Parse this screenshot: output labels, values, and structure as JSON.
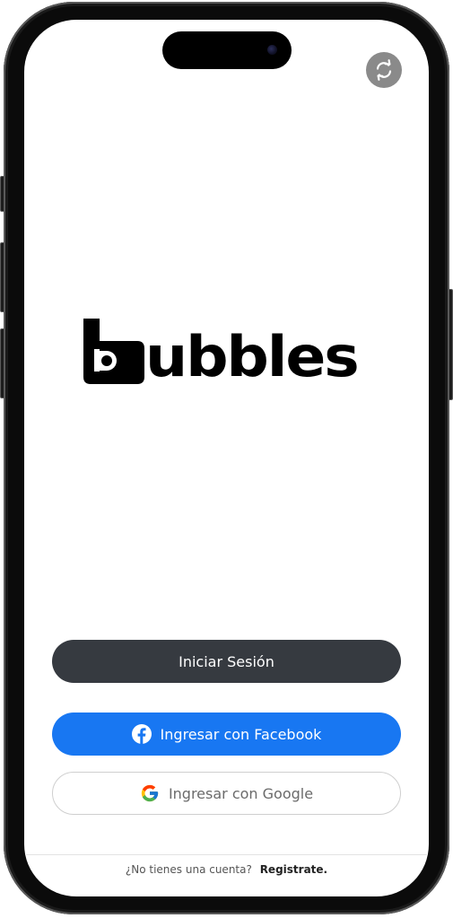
{
  "app": {
    "brand_name": "bubbles",
    "logo_letter": "b"
  },
  "header": {
    "refresh_icon": "refresh-icon"
  },
  "actions": {
    "login_label": "Iniciar Sesión",
    "facebook_label": "Ingresar con Facebook",
    "facebook_icon": "facebook-icon",
    "google_label": "Ingresar con Google",
    "google_icon": "google-icon"
  },
  "footer": {
    "prompt": "¿No tienes una cuenta?",
    "signup_label": "Registrate."
  },
  "colors": {
    "primary_dark": "#363a40",
    "facebook_blue": "#1877f2",
    "refresh_gray": "#8a8a8a"
  }
}
